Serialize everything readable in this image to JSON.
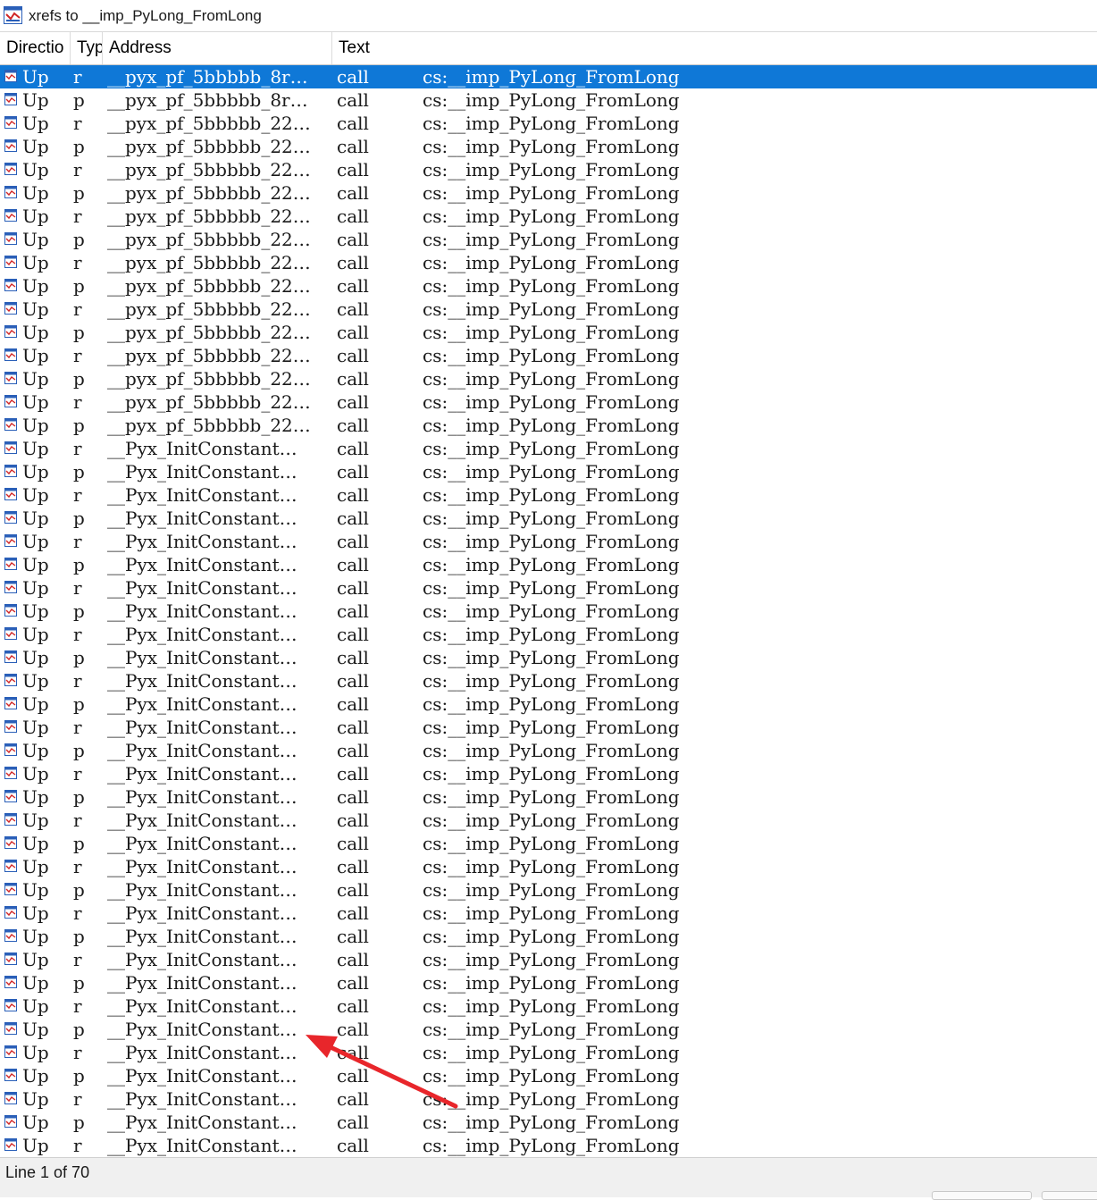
{
  "window": {
    "title": "xrefs to __imp_PyLong_FromLong",
    "icon": "xref-window-icon"
  },
  "columns": [
    "Directio",
    "Typ",
    "Address",
    "Text"
  ],
  "rows": [
    {
      "dir": "Up",
      "type": "r",
      "address": "__pyx_pf_5bbbbb_8r…",
      "text": "call",
      "operand": "cs:__imp_PyLong_FromLong",
      "selected": true
    },
    {
      "dir": "Up",
      "type": "p",
      "address": "__pyx_pf_5bbbbb_8r…",
      "text": "call",
      "operand": "cs:__imp_PyLong_FromLong"
    },
    {
      "dir": "Up",
      "type": "r",
      "address": "__pyx_pf_5bbbbb_22…",
      "text": "call",
      "operand": "cs:__imp_PyLong_FromLong"
    },
    {
      "dir": "Up",
      "type": "p",
      "address": "__pyx_pf_5bbbbb_22…",
      "text": "call",
      "operand": "cs:__imp_PyLong_FromLong"
    },
    {
      "dir": "Up",
      "type": "r",
      "address": "__pyx_pf_5bbbbb_22…",
      "text": "call",
      "operand": "cs:__imp_PyLong_FromLong"
    },
    {
      "dir": "Up",
      "type": "p",
      "address": "__pyx_pf_5bbbbb_22…",
      "text": "call",
      "operand": "cs:__imp_PyLong_FromLong"
    },
    {
      "dir": "Up",
      "type": "r",
      "address": "__pyx_pf_5bbbbb_22…",
      "text": "call",
      "operand": "cs:__imp_PyLong_FromLong"
    },
    {
      "dir": "Up",
      "type": "p",
      "address": "__pyx_pf_5bbbbb_22…",
      "text": "call",
      "operand": "cs:__imp_PyLong_FromLong"
    },
    {
      "dir": "Up",
      "type": "r",
      "address": "__pyx_pf_5bbbbb_22…",
      "text": "call",
      "operand": "cs:__imp_PyLong_FromLong"
    },
    {
      "dir": "Up",
      "type": "p",
      "address": "__pyx_pf_5bbbbb_22…",
      "text": "call",
      "operand": "cs:__imp_PyLong_FromLong"
    },
    {
      "dir": "Up",
      "type": "r",
      "address": "__pyx_pf_5bbbbb_22…",
      "text": "call",
      "operand": "cs:__imp_PyLong_FromLong"
    },
    {
      "dir": "Up",
      "type": "p",
      "address": "__pyx_pf_5bbbbb_22…",
      "text": "call",
      "operand": "cs:__imp_PyLong_FromLong"
    },
    {
      "dir": "Up",
      "type": "r",
      "address": "__pyx_pf_5bbbbb_22…",
      "text": "call",
      "operand": "cs:__imp_PyLong_FromLong"
    },
    {
      "dir": "Up",
      "type": "p",
      "address": "__pyx_pf_5bbbbb_22…",
      "text": "call",
      "operand": "cs:__imp_PyLong_FromLong"
    },
    {
      "dir": "Up",
      "type": "r",
      "address": "__pyx_pf_5bbbbb_22…",
      "text": "call",
      "operand": "cs:__imp_PyLong_FromLong"
    },
    {
      "dir": "Up",
      "type": "p",
      "address": "__pyx_pf_5bbbbb_22…",
      "text": "call",
      "operand": "cs:__imp_PyLong_FromLong"
    },
    {
      "dir": "Up",
      "type": "r",
      "address": "__Pyx_InitConstant…",
      "text": "call",
      "operand": "cs:__imp_PyLong_FromLong"
    },
    {
      "dir": "Up",
      "type": "p",
      "address": "__Pyx_InitConstant…",
      "text": "call",
      "operand": "cs:__imp_PyLong_FromLong"
    },
    {
      "dir": "Up",
      "type": "r",
      "address": "__Pyx_InitConstant…",
      "text": "call",
      "operand": "cs:__imp_PyLong_FromLong"
    },
    {
      "dir": "Up",
      "type": "p",
      "address": "__Pyx_InitConstant…",
      "text": "call",
      "operand": "cs:__imp_PyLong_FromLong"
    },
    {
      "dir": "Up",
      "type": "r",
      "address": "__Pyx_InitConstant…",
      "text": "call",
      "operand": "cs:__imp_PyLong_FromLong"
    },
    {
      "dir": "Up",
      "type": "p",
      "address": "__Pyx_InitConstant…",
      "text": "call",
      "operand": "cs:__imp_PyLong_FromLong"
    },
    {
      "dir": "Up",
      "type": "r",
      "address": "__Pyx_InitConstant…",
      "text": "call",
      "operand": "cs:__imp_PyLong_FromLong"
    },
    {
      "dir": "Up",
      "type": "p",
      "address": "__Pyx_InitConstant…",
      "text": "call",
      "operand": "cs:__imp_PyLong_FromLong"
    },
    {
      "dir": "Up",
      "type": "r",
      "address": "__Pyx_InitConstant…",
      "text": "call",
      "operand": "cs:__imp_PyLong_FromLong"
    },
    {
      "dir": "Up",
      "type": "p",
      "address": "__Pyx_InitConstant…",
      "text": "call",
      "operand": "cs:__imp_PyLong_FromLong"
    },
    {
      "dir": "Up",
      "type": "r",
      "address": "__Pyx_InitConstant…",
      "text": "call",
      "operand": "cs:__imp_PyLong_FromLong"
    },
    {
      "dir": "Up",
      "type": "p",
      "address": "__Pyx_InitConstant…",
      "text": "call",
      "operand": "cs:__imp_PyLong_FromLong"
    },
    {
      "dir": "Up",
      "type": "r",
      "address": "__Pyx_InitConstant…",
      "text": "call",
      "operand": "cs:__imp_PyLong_FromLong"
    },
    {
      "dir": "Up",
      "type": "p",
      "address": "__Pyx_InitConstant…",
      "text": "call",
      "operand": "cs:__imp_PyLong_FromLong"
    },
    {
      "dir": "Up",
      "type": "r",
      "address": "__Pyx_InitConstant…",
      "text": "call",
      "operand": "cs:__imp_PyLong_FromLong"
    },
    {
      "dir": "Up",
      "type": "p",
      "address": "__Pyx_InitConstant…",
      "text": "call",
      "operand": "cs:__imp_PyLong_FromLong"
    },
    {
      "dir": "Up",
      "type": "r",
      "address": "__Pyx_InitConstant…",
      "text": "call",
      "operand": "cs:__imp_PyLong_FromLong"
    },
    {
      "dir": "Up",
      "type": "p",
      "address": "__Pyx_InitConstant…",
      "text": "call",
      "operand": "cs:__imp_PyLong_FromLong"
    },
    {
      "dir": "Up",
      "type": "r",
      "address": "__Pyx_InitConstant…",
      "text": "call",
      "operand": "cs:__imp_PyLong_FromLong"
    },
    {
      "dir": "Up",
      "type": "p",
      "address": "__Pyx_InitConstant…",
      "text": "call",
      "operand": "cs:__imp_PyLong_FromLong"
    },
    {
      "dir": "Up",
      "type": "r",
      "address": "__Pyx_InitConstant…",
      "text": "call",
      "operand": "cs:__imp_PyLong_FromLong"
    },
    {
      "dir": "Up",
      "type": "p",
      "address": "__Pyx_InitConstant…",
      "text": "call",
      "operand": "cs:__imp_PyLong_FromLong"
    },
    {
      "dir": "Up",
      "type": "r",
      "address": "__Pyx_InitConstant…",
      "text": "call",
      "operand": "cs:__imp_PyLong_FromLong"
    },
    {
      "dir": "Up",
      "type": "p",
      "address": "__Pyx_InitConstant…",
      "text": "call",
      "operand": "cs:__imp_PyLong_FromLong"
    },
    {
      "dir": "Up",
      "type": "r",
      "address": "__Pyx_InitConstant…",
      "text": "call",
      "operand": "cs:__imp_PyLong_FromLong"
    },
    {
      "dir": "Up",
      "type": "p",
      "address": "__Pyx_InitConstant…",
      "text": "call",
      "operand": "cs:__imp_PyLong_FromLong"
    },
    {
      "dir": "Up",
      "type": "r",
      "address": "__Pyx_InitConstant…",
      "text": "call",
      "operand": "cs:__imp_PyLong_FromLong"
    },
    {
      "dir": "Up",
      "type": "p",
      "address": "__Pyx_InitConstant…",
      "text": "call",
      "operand": "cs:__imp_PyLong_FromLong"
    },
    {
      "dir": "Up",
      "type": "r",
      "address": "__Pyx_InitConstant…",
      "text": "call",
      "operand": "cs:__imp_PyLong_FromLong"
    },
    {
      "dir": "Up",
      "type": "p",
      "address": "__Pyx_InitConstant…",
      "text": "call",
      "operand": "cs:__imp_PyLong_FromLong"
    },
    {
      "dir": "Up",
      "type": "r",
      "address": "__Pyx_InitConstant…",
      "text": "call",
      "operand": "cs:__imp_PyLong_FromLong"
    }
  ],
  "status": {
    "text": "Line 1 of 70"
  },
  "annotation": {
    "type": "red-arrow",
    "color": "#e8262b"
  },
  "colors": {
    "selection": "#0f78d7",
    "arrow": "#e8262b"
  }
}
